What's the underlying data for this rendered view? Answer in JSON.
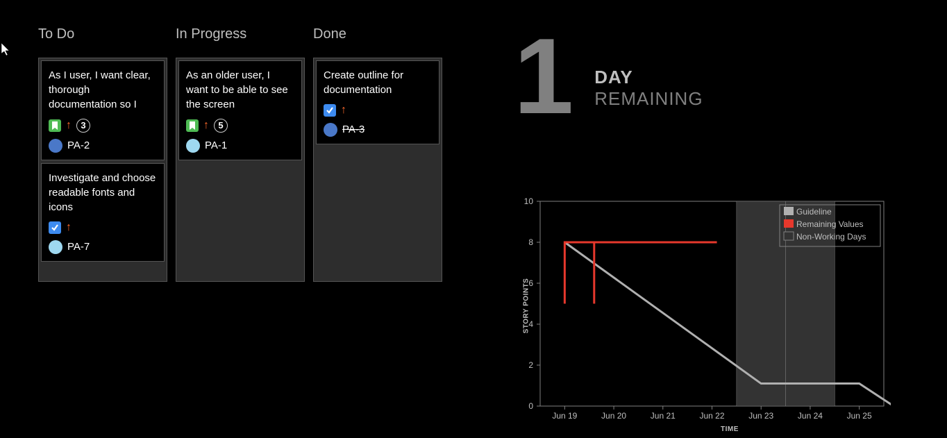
{
  "board": {
    "columns": [
      {
        "title": "To Do",
        "cards": [
          {
            "title": "As I user, I want clear, thorough documentation so I",
            "type": "story",
            "priority": "up",
            "estimate": "3",
            "avatar_color": "#4a78c8",
            "issue_key": "PA-2",
            "done": false
          },
          {
            "title": "Investigate and choose readable fonts and icons",
            "type": "task",
            "priority": "up",
            "estimate": null,
            "avatar_color": "#9ed8f0",
            "issue_key": "PA-7",
            "done": false
          }
        ]
      },
      {
        "title": "In Progress",
        "cards": [
          {
            "title": "As an older user, I want to be able to see the screen",
            "type": "story",
            "priority": "up",
            "estimate": "5",
            "avatar_color": "#9ed8f0",
            "issue_key": "PA-1",
            "done": false
          }
        ]
      },
      {
        "title": "Done",
        "cards": [
          {
            "title": "Create outline for documentation",
            "type": "task",
            "priority": "up",
            "estimate": null,
            "avatar_color": "#4a78c8",
            "issue_key": "PA-3",
            "done": true
          }
        ]
      }
    ]
  },
  "countdown": {
    "number": "1",
    "line1": "DAY",
    "line2": "REMAINING"
  },
  "chart": {
    "ylabel": "STORY POINTS",
    "xlabel": "TIME",
    "legend": {
      "guideline": "Guideline",
      "remaining": "Remaining Values",
      "nonworking": "Non-Working Days"
    },
    "chart_data": {
      "type": "line",
      "xlabel": "TIME",
      "ylabel": "STORY POINTS",
      "ylim": [
        0,
        10
      ],
      "y_ticks": [
        0,
        2,
        4,
        6,
        8,
        10
      ],
      "x_categories": [
        "Jun 19",
        "Jun 20",
        "Jun 21",
        "Jun 22",
        "Jun 23",
        "Jun 24",
        "Jun 25"
      ],
      "non_working_days": [
        "Jun 23",
        "Jun 24"
      ],
      "series": [
        {
          "name": "Guideline",
          "color": "#b0b0b0",
          "points": [
            {
              "x": "Jun 19",
              "y": 8
            },
            {
              "x": "Jun 23",
              "y": 1.1
            },
            {
              "x": "Jun 25",
              "y": 1.1
            },
            {
              "x": "Jun 25.7",
              "y": 0
            }
          ]
        },
        {
          "name": "Remaining Values",
          "color": "#e6382c",
          "points": [
            {
              "x": "Jun 19",
              "y": 5
            },
            {
              "x": "Jun 19",
              "y": 8
            },
            {
              "x": "Jun 19.6",
              "y": 8
            },
            {
              "x": "Jun 19.6",
              "y": 5
            },
            {
              "x": "Jun 19.6",
              "y": 8
            },
            {
              "x": "Jun 22.1",
              "y": 8
            }
          ]
        }
      ],
      "legend_entries": [
        "Guideline",
        "Remaining Values",
        "Non-Working Days"
      ]
    }
  }
}
